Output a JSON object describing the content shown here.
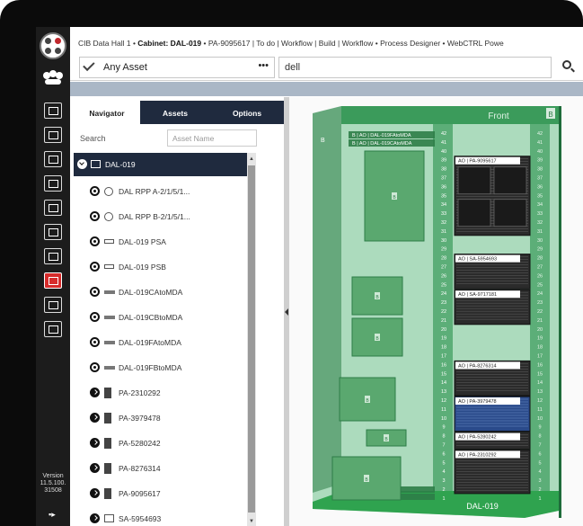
{
  "breadcrumb": {
    "items": [
      "CIB Data Hall 1",
      "Cabinet: DAL-019",
      "PA-9095617",
      "To do",
      "Workflow",
      "Build",
      "Workflow",
      "Process Designer",
      "WebCTRL Powe"
    ],
    "current": "Cabinet: DAL-019"
  },
  "search": {
    "asset_type": "Any Asset",
    "more": "•••",
    "query": "dell"
  },
  "rail": {
    "version_label": "Version",
    "version_number": "11.5.100.",
    "build": "31508",
    "exit_glyph": "▪▸"
  },
  "tabs": [
    "Navigator",
    "Assets",
    "Options"
  ],
  "filters": {
    "search_label": "Search",
    "name_placeholder": "Asset Name"
  },
  "tree": {
    "root": "DAL-019",
    "children": [
      {
        "label": "DAL RPP A-2/1/5/1...",
        "icon": "disk-icon",
        "expanded": true
      },
      {
        "label": "DAL RPP B-2/1/5/1...",
        "icon": "disk-icon",
        "expanded": true
      },
      {
        "label": "DAL-019 PSA",
        "icon": "pdu-icon",
        "expanded": true
      },
      {
        "label": "DAL-019 PSB",
        "icon": "pdu-icon",
        "expanded": true
      },
      {
        "label": "DAL-019CAtoMDA",
        "icon": "patch-panel-icon",
        "expanded": true
      },
      {
        "label": "DAL-019CBtoMDA",
        "icon": "patch-panel-icon",
        "expanded": true
      },
      {
        "label": "DAL-019FAtoMDA",
        "icon": "patch-panel-icon",
        "expanded": true
      },
      {
        "label": "DAL-019FBtoMDA",
        "icon": "patch-panel-icon",
        "expanded": true
      },
      {
        "label": "PA-2310292",
        "icon": "device-icon",
        "expanded": false
      },
      {
        "label": "PA-3979478",
        "icon": "device-icon",
        "expanded": false
      },
      {
        "label": "PA-5280242",
        "icon": "device-icon",
        "expanded": false
      },
      {
        "label": "PA-8276314",
        "icon": "device-icon",
        "expanded": false
      },
      {
        "label": "PA-9095617",
        "icon": "device-icon",
        "expanded": false
      },
      {
        "label": "SA-5954693",
        "icon": "server-icon",
        "expanded": false
      }
    ]
  },
  "rack": {
    "front_label": "Front",
    "side_label": "B",
    "left_side_label": "B",
    "cabinet_name": "DAL-019",
    "unit_count": 42,
    "top_tags": [
      "B | AO | DAL-019FAtoMDA",
      "B | AO | DAL-019CAtoMDA"
    ],
    "bottom_tags": [
      "B | AO | DAL-019FB...",
      "B | AO | DAL-019CB..."
    ],
    "devices": [
      {
        "label": "AO | PA-9095617"
      },
      {
        "label": "AO | SA-5954693"
      },
      {
        "label": "AO | SA-9717181"
      },
      {
        "label": "AO | PA-8276314"
      },
      {
        "label": "AO | PA-3979478"
      },
      {
        "label": "AO | PA-5280242"
      },
      {
        "label": "AO | PA-2310292"
      }
    ],
    "pdu_badges": [
      "B",
      "B",
      "B",
      "B",
      "B",
      "B"
    ]
  },
  "colors": {
    "rail_bg": "#1c1c1c",
    "header_bg": "#1f2a3e",
    "rack_green": "#3b9b5b",
    "rack_dark": "#2d7d47",
    "rack_light": "#6cc18a",
    "pdu_green": "#5aa86f"
  }
}
